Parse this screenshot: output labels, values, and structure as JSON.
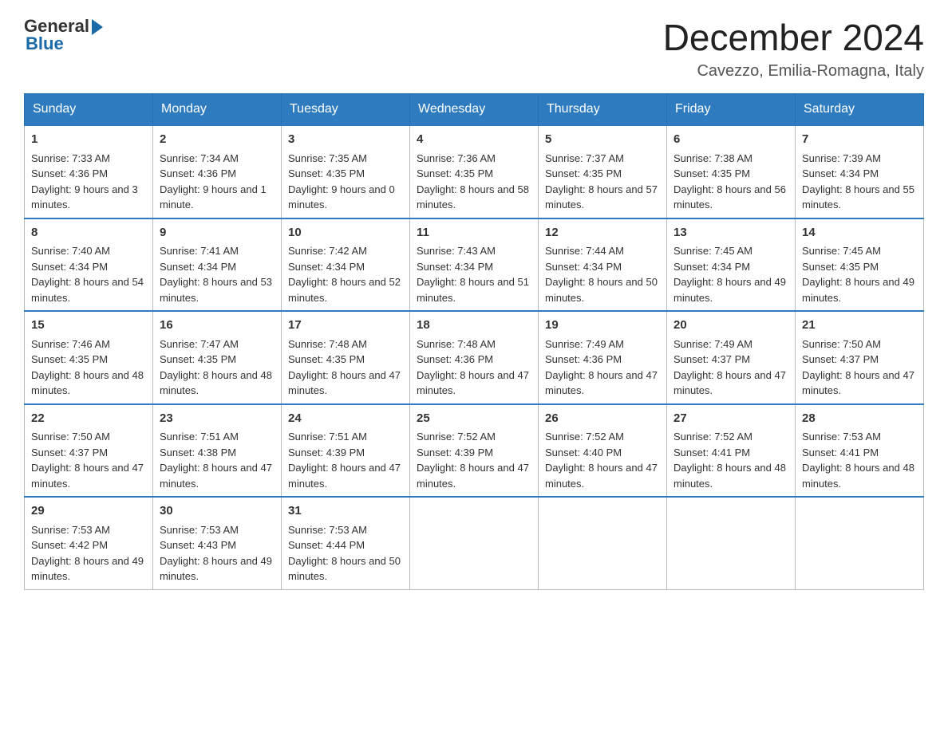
{
  "logo": {
    "general": "General",
    "blue": "Blue"
  },
  "title": "December 2024",
  "location": "Cavezzo, Emilia-Romagna, Italy",
  "days_of_week": [
    "Sunday",
    "Monday",
    "Tuesday",
    "Wednesday",
    "Thursday",
    "Friday",
    "Saturday"
  ],
  "weeks": [
    [
      {
        "day": "1",
        "sunrise": "7:33 AM",
        "sunset": "4:36 PM",
        "daylight": "9 hours and 3 minutes."
      },
      {
        "day": "2",
        "sunrise": "7:34 AM",
        "sunset": "4:36 PM",
        "daylight": "9 hours and 1 minute."
      },
      {
        "day": "3",
        "sunrise": "7:35 AM",
        "sunset": "4:35 PM",
        "daylight": "9 hours and 0 minutes."
      },
      {
        "day": "4",
        "sunrise": "7:36 AM",
        "sunset": "4:35 PM",
        "daylight": "8 hours and 58 minutes."
      },
      {
        "day": "5",
        "sunrise": "7:37 AM",
        "sunset": "4:35 PM",
        "daylight": "8 hours and 57 minutes."
      },
      {
        "day": "6",
        "sunrise": "7:38 AM",
        "sunset": "4:35 PM",
        "daylight": "8 hours and 56 minutes."
      },
      {
        "day": "7",
        "sunrise": "7:39 AM",
        "sunset": "4:34 PM",
        "daylight": "8 hours and 55 minutes."
      }
    ],
    [
      {
        "day": "8",
        "sunrise": "7:40 AM",
        "sunset": "4:34 PM",
        "daylight": "8 hours and 54 minutes."
      },
      {
        "day": "9",
        "sunrise": "7:41 AM",
        "sunset": "4:34 PM",
        "daylight": "8 hours and 53 minutes."
      },
      {
        "day": "10",
        "sunrise": "7:42 AM",
        "sunset": "4:34 PM",
        "daylight": "8 hours and 52 minutes."
      },
      {
        "day": "11",
        "sunrise": "7:43 AM",
        "sunset": "4:34 PM",
        "daylight": "8 hours and 51 minutes."
      },
      {
        "day": "12",
        "sunrise": "7:44 AM",
        "sunset": "4:34 PM",
        "daylight": "8 hours and 50 minutes."
      },
      {
        "day": "13",
        "sunrise": "7:45 AM",
        "sunset": "4:34 PM",
        "daylight": "8 hours and 49 minutes."
      },
      {
        "day": "14",
        "sunrise": "7:45 AM",
        "sunset": "4:35 PM",
        "daylight": "8 hours and 49 minutes."
      }
    ],
    [
      {
        "day": "15",
        "sunrise": "7:46 AM",
        "sunset": "4:35 PM",
        "daylight": "8 hours and 48 minutes."
      },
      {
        "day": "16",
        "sunrise": "7:47 AM",
        "sunset": "4:35 PM",
        "daylight": "8 hours and 48 minutes."
      },
      {
        "day": "17",
        "sunrise": "7:48 AM",
        "sunset": "4:35 PM",
        "daylight": "8 hours and 47 minutes."
      },
      {
        "day": "18",
        "sunrise": "7:48 AM",
        "sunset": "4:36 PM",
        "daylight": "8 hours and 47 minutes."
      },
      {
        "day": "19",
        "sunrise": "7:49 AM",
        "sunset": "4:36 PM",
        "daylight": "8 hours and 47 minutes."
      },
      {
        "day": "20",
        "sunrise": "7:49 AM",
        "sunset": "4:37 PM",
        "daylight": "8 hours and 47 minutes."
      },
      {
        "day": "21",
        "sunrise": "7:50 AM",
        "sunset": "4:37 PM",
        "daylight": "8 hours and 47 minutes."
      }
    ],
    [
      {
        "day": "22",
        "sunrise": "7:50 AM",
        "sunset": "4:37 PM",
        "daylight": "8 hours and 47 minutes."
      },
      {
        "day": "23",
        "sunrise": "7:51 AM",
        "sunset": "4:38 PM",
        "daylight": "8 hours and 47 minutes."
      },
      {
        "day": "24",
        "sunrise": "7:51 AM",
        "sunset": "4:39 PM",
        "daylight": "8 hours and 47 minutes."
      },
      {
        "day": "25",
        "sunrise": "7:52 AM",
        "sunset": "4:39 PM",
        "daylight": "8 hours and 47 minutes."
      },
      {
        "day": "26",
        "sunrise": "7:52 AM",
        "sunset": "4:40 PM",
        "daylight": "8 hours and 47 minutes."
      },
      {
        "day": "27",
        "sunrise": "7:52 AM",
        "sunset": "4:41 PM",
        "daylight": "8 hours and 48 minutes."
      },
      {
        "day": "28",
        "sunrise": "7:53 AM",
        "sunset": "4:41 PM",
        "daylight": "8 hours and 48 minutes."
      }
    ],
    [
      {
        "day": "29",
        "sunrise": "7:53 AM",
        "sunset": "4:42 PM",
        "daylight": "8 hours and 49 minutes."
      },
      {
        "day": "30",
        "sunrise": "7:53 AM",
        "sunset": "4:43 PM",
        "daylight": "8 hours and 49 minutes."
      },
      {
        "day": "31",
        "sunrise": "7:53 AM",
        "sunset": "4:44 PM",
        "daylight": "8 hours and 50 minutes."
      },
      null,
      null,
      null,
      null
    ]
  ],
  "cell_labels": {
    "sunrise": "Sunrise:",
    "sunset": "Sunset:",
    "daylight": "Daylight:"
  }
}
